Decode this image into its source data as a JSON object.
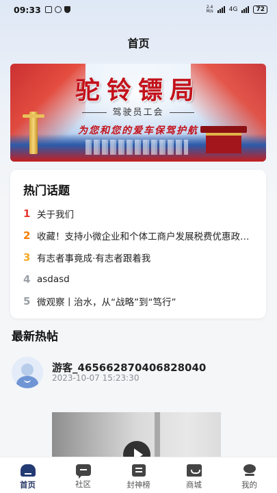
{
  "status_bar": {
    "time": "09:33",
    "net_speed_top": "2.4",
    "net_speed_bottom": "M/s",
    "signal_label": "4G",
    "battery": "72"
  },
  "header": {
    "title": "首页"
  },
  "banner": {
    "title": "驼铃镖局",
    "subtitle": "驾驶员工会",
    "slogan": "为您和您的爱车保驾护航"
  },
  "hot_topics": {
    "heading": "热门话题",
    "items": [
      {
        "rank": "1",
        "text": "关于我们",
        "color": "#e53935"
      },
      {
        "rank": "2",
        "text": "收藏！支持小微企业和个体工商户发展税费优惠政策指引",
        "color": "#f57c00"
      },
      {
        "rank": "3",
        "text": "有志者事竟成·有志者跟着我",
        "color": "#f9a825"
      },
      {
        "rank": "4",
        "text": "asdasd",
        "color": "#9aa0a6"
      },
      {
        "rank": "5",
        "text": "微观察丨治水，从“战略”到“笃行”",
        "color": "#9aa0a6"
      }
    ]
  },
  "latest_posts": {
    "heading": "最新热帖",
    "post": {
      "author": "游客_465662870406828040",
      "time": "2023-10-07 15:23:30"
    }
  },
  "tab_bar": {
    "items": [
      {
        "label": "首页",
        "icon": "home-icon",
        "active": true
      },
      {
        "label": "社区",
        "icon": "chat-icon",
        "active": false
      },
      {
        "label": "封神榜",
        "icon": "list-icon",
        "active": false
      },
      {
        "label": "商城",
        "icon": "shop-icon",
        "active": false
      },
      {
        "label": "我的",
        "icon": "user-icon",
        "active": false
      }
    ]
  },
  "colors": {
    "accent": "#233a73",
    "banner_red": "#c3121b"
  }
}
